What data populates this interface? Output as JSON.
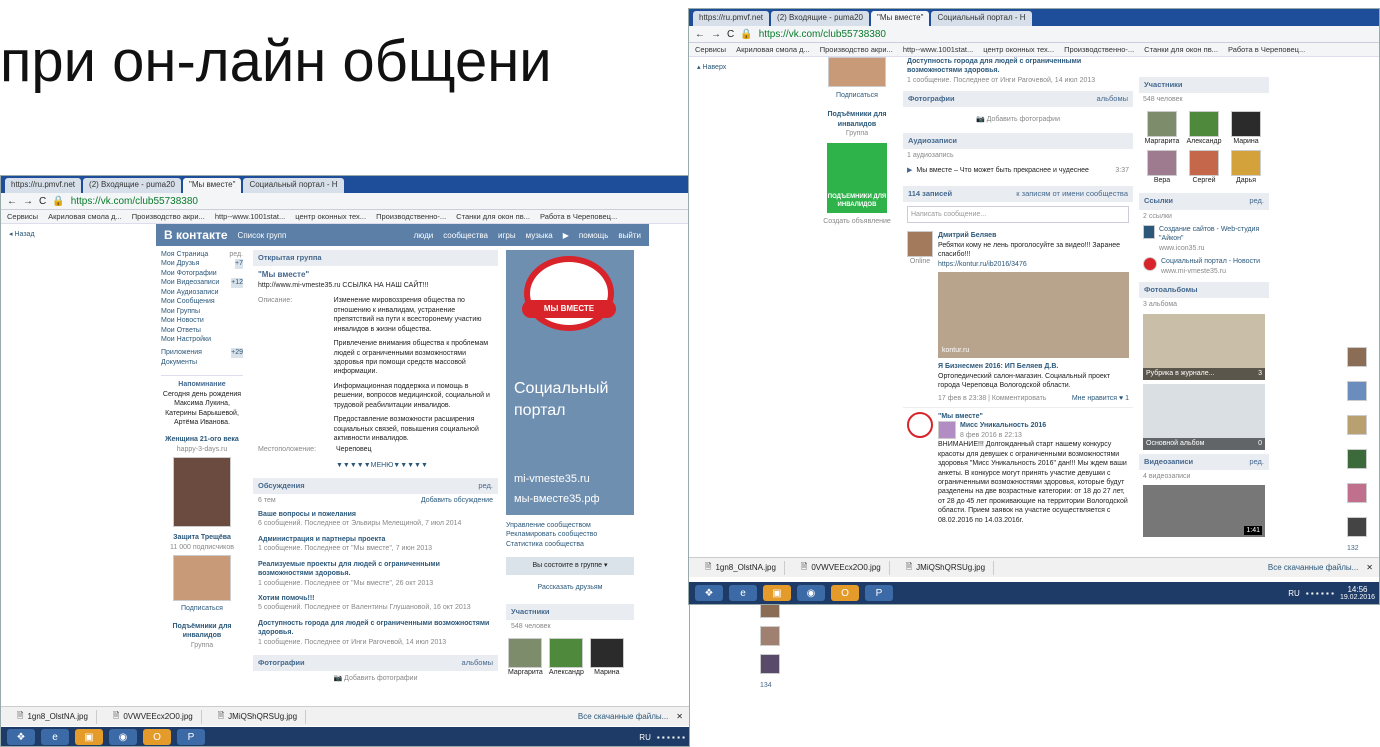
{
  "slide": {
    "title": "при он-лайн общени"
  },
  "tabs": [
    "https://ru.pmvf.net",
    "(2) Входящие - puma20",
    "\"Мы вместе\"",
    "Социальный портал - Н"
  ],
  "address": "https://vk.com/club55738380",
  "bookmarks": [
    "Сервисы",
    "Акриловая смола д...",
    "Производство акри...",
    "http--www.1001stat...",
    "центр оконных тех...",
    "Производственно-...",
    "Станки для окон пв...",
    "Работа в Череповец..."
  ],
  "vk": {
    "brand": "В контакте",
    "back": "Назад",
    "search": "Список групп",
    "nav": [
      "люди",
      "сообщества",
      "игры",
      "музыка",
      "помощь",
      "выйти"
    ],
    "menu": [
      "Моя Страница",
      "Мои Друзья",
      "Мои Фотографии",
      "Мои Видеозаписи",
      "Мои Аудиозаписи",
      "Мои Сообщения",
      "Мои Группы",
      "Мои Новости",
      "Мои Ответы",
      "Мои Настройки",
      "Приложения",
      "Документы"
    ],
    "menu_edit": "ред.",
    "menu_badges": {
      "friends": "+7",
      "video": "+12",
      "apps": "+29"
    },
    "reminder_title": "Напоминание",
    "reminder_text": "Сегодня день рождения Максима Лукина, Катерины Барышевой, Артёма Иванова.",
    "ad1_title": "Женщина 21-ого века",
    "ad1_sub": "happy-3-days.ru",
    "ad2_title": "Защита Трещёва",
    "ad2_sub": "11 000 подписчиков",
    "subscribe": "Подписаться",
    "lifts_title": "Подъёмники для инвалидов",
    "lifts_sub": "Группа",
    "group_type": "Открытая группа",
    "group_name": "\"Мы вместе\"",
    "group_link": "http://www.mi-vmeste35.ru ССЫЛКА НА НАШ САЙТ!!!",
    "desc_label": "Описание:",
    "desc": [
      "Изменение мировоззрения общества по отношению к инвалидам, устранение препятствий на пути к всесторонему участию инвалидов в жизни общества.",
      "Привлечение внимания общества к проблемам людей с ограниченными возможностями здоровья при помощи средств массовой информации.",
      "Информационная поддержка и помощь в решении, вопросов медицинской, социальной и трудовой реабилитации инвалидов.",
      "Предоставление возможности расширения социальных связей, повышения социальной активности инвалидов."
    ],
    "loc_label": "Местоположение:",
    "loc": "Череповец",
    "menu_link": "▼▼▼▼▼МЕНЮ▼▼▼▼▼",
    "discussions": "Обсуждения",
    "disc_count": "6 тем",
    "disc_add": "Добавить обсуждение",
    "topics": [
      {
        "t": "Ваше вопросы и пожелания",
        "m": "6 сообщений. Последнее от Эльвиры Мелещиной, 7 июл 2014"
      },
      {
        "t": "Администрация и партнеры проекта",
        "m": "1 сообщение. Последнее от \"Мы вместе\", 7 июн 2013"
      },
      {
        "t": "Реализуемые проекты для людей с ограниченными возможностями здоровья.",
        "m": "1 сообщение. Последнее от \"Мы вместе\", 26 окт 2013"
      },
      {
        "t": "Хотим помочь!!!",
        "m": "5 сообщений. Последнее от Валентины Глушановой, 16 окт 2013"
      },
      {
        "t": "Доступность города для людей с ограниченными возможностями здоровья.",
        "m": "1 сообщение. Последнее от Инги Рагочевой, 14 июл 2013"
      }
    ],
    "photos": "Фотографии",
    "albums": "альбомы",
    "add_photo": "Добавить фотографии",
    "banner_logo": "МЫ ВМЕСТЕ",
    "banner_text": "Социальный портал",
    "banner_url1": "mi-vmeste35.ru",
    "banner_url2": "мы-вместе35.рф",
    "mgmt": [
      "Управление сообществом",
      "Рекламировать сообщество",
      "Статистика сообщества"
    ],
    "member_btn": "Вы состоите в группе",
    "tell": "Рассказать друзьям",
    "members": "Участники",
    "members_count": "548 человек",
    "member_names": [
      "Маргарита",
      "Александр",
      "Марина"
    ]
  },
  "vk2": {
    "lifts_title": "Подъёмники для инвалидов",
    "lifts_img": "ПОДЪЕМНИКИ ДЛЯ ИНВАЛИДОВ",
    "create_ad": "Создать объявление",
    "audio": "Аудиозаписи",
    "audio_count": "1 аудиозапись",
    "track": "Мы вместе – Что может быть прекраснее и чудеснее",
    "track_time": "3:37",
    "posts": "114 записей",
    "posts_filter": "к записям от имени сообщества",
    "write": "Написать сообщение...",
    "p1_author": "Дмитрий Беляев",
    "p1_text": "Ребятки кому не лень проголосуйте за видео!!! Заранее спасибо!!!",
    "p1_link": "https://kontur.ru/ib2016/3476",
    "online": "Online",
    "video_caption": "kontur.ru",
    "p1_title": "Я Бизнесмен 2016: ИП Беляев Д.В.",
    "p1_desc": "Ортопедический салон-магазин. Социальный проект города Череповца Вологодской области.",
    "p1_date": "17 фев в 23:38 | Комментировать",
    "p1_like": "Мне нравится ♥ 1",
    "p2_author": "\"Мы вместе\"",
    "p2_repost": "Мисс Уникальность 2016",
    "p2_date": "8 фев 2016 в 22:13",
    "p2_text": "ВНИМАНИЕ!!! Долгожданный старт нашему конкурсу красоты для девушек с ограниченными возможностями здоровья \"Мисс Уникальность 2016\" дан!!! Мы ждем ваши анкеты. В конкурсе могут принять участие девушки с ограниченными возможностями здоровья, которые будут разделены на две возрастные категории: от 18 до 27 лет, от 28 до 45 лет проживающие на территории Вологодской области. Прием заявок на участие осуществляется с 08.02.2016 по 14.03.2016г.",
    "links": "Ссылки",
    "links_count": "2 ссылки",
    "link1": "Создание сайтов - Web-студия \"Айкон\"",
    "link1_sub": "www.icon35.ru",
    "link2": "Социальный портал - Новости",
    "link2_sub": "www.mi-vmeste35.ru",
    "photo_albums": "Фотоальбомы",
    "albums_count": "3 альбома",
    "album1": "Рубрика в журнале...",
    "album1_n": "3",
    "album2": "Основной альбом",
    "album2_n": "0",
    "videos": "Видеозаписи",
    "videos_count": "4 видеозаписи",
    "video_time": "1:41",
    "member_names": [
      "Маргарита",
      "Александр",
      "Марина",
      "Вера",
      "Сергей",
      "Дарья"
    ],
    "up": "Наверх",
    "count_right": "132"
  },
  "downloads": [
    "1gn8_OlstNA.jpg",
    "0VWVEEcx2O0.jpg",
    "JMiQShQRSUg.jpg"
  ],
  "all_downloads": "Все скачанные файлы...",
  "tray": {
    "lang": "RU",
    "time": "14:56",
    "date": "19.02.2016"
  },
  "side_count": "134"
}
